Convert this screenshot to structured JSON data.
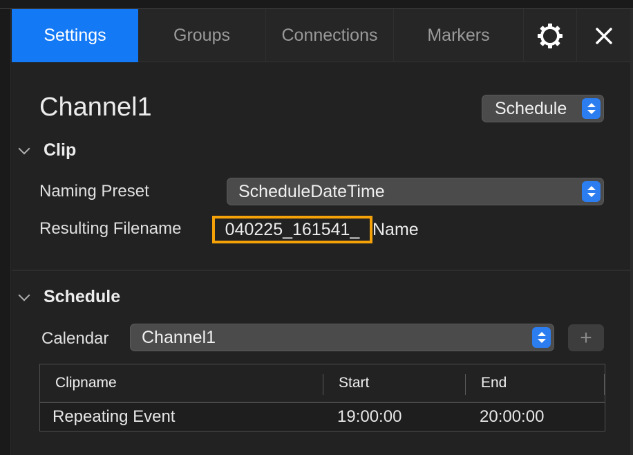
{
  "tabs": [
    {
      "label": "Settings",
      "active": true
    },
    {
      "label": "Groups",
      "active": false
    },
    {
      "label": "Connections",
      "active": false
    },
    {
      "label": "Markers",
      "active": false
    }
  ],
  "tab_icons": {
    "settings": "gear-icon",
    "close": "close-icon"
  },
  "channel": {
    "title": "Channel1",
    "mode_selected": "Schedule"
  },
  "clip": {
    "header": "Clip",
    "naming_label": "Naming Preset",
    "naming_value": "ScheduleDateTime",
    "result_label": "Resulting Filename",
    "filename_highlighted": "040225_161541_",
    "filename_rest": "Name"
  },
  "schedule": {
    "header": "Schedule",
    "calendar_label": "Calendar",
    "calendar_value": "Channel1",
    "add_label": "+",
    "columns": [
      "Clipname",
      "Start",
      "End"
    ],
    "rows": [
      {
        "clipname": "Repeating Event",
        "start": "19:00:00",
        "end": "20:00:00"
      }
    ]
  },
  "colors": {
    "accent": "#1479f5",
    "highlight_border": "#f5a208",
    "background": "#222222"
  }
}
